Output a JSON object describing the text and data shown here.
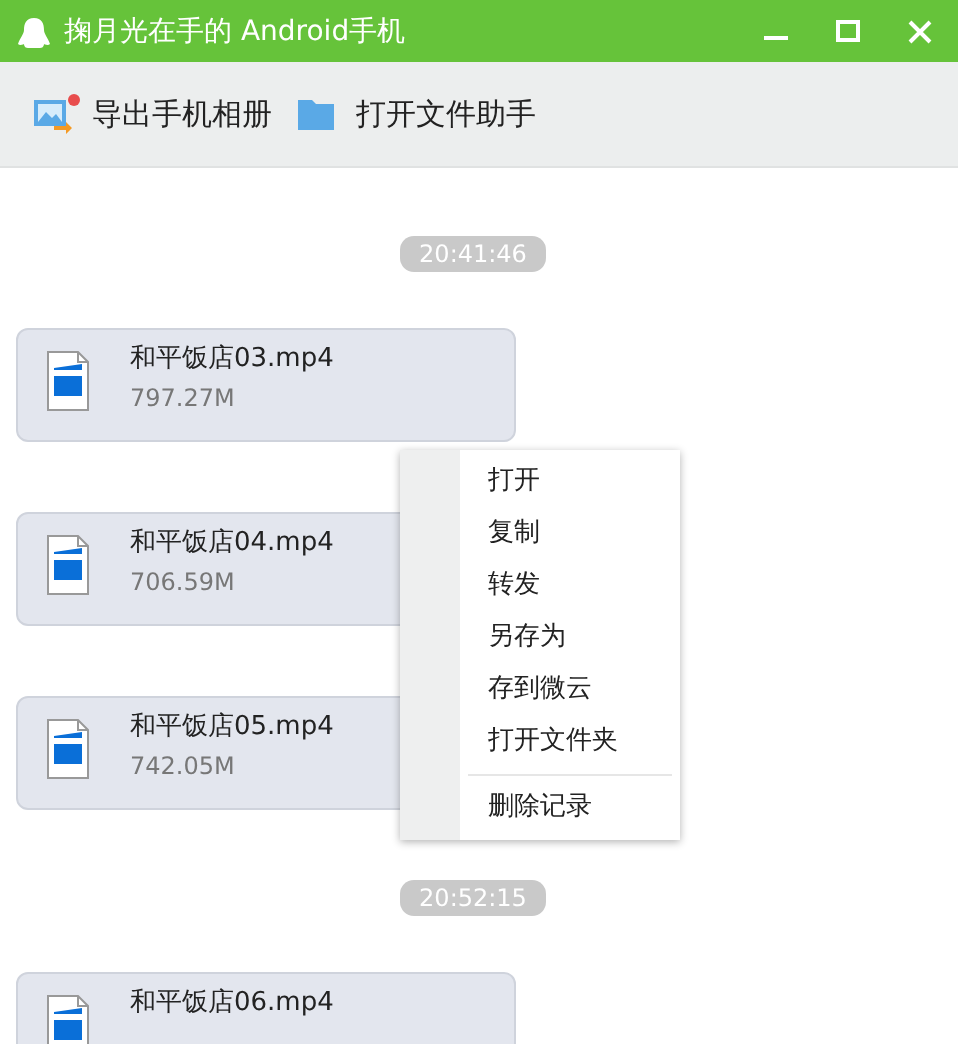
{
  "window": {
    "title": "掬月光在手的 Android手机"
  },
  "toolbar": [
    {
      "label": "导出手机相册",
      "kind": "album",
      "badge": true
    },
    {
      "label": "打开文件助手",
      "kind": "folder",
      "badge": false
    }
  ],
  "messages": [
    {
      "kind": "time",
      "text": "20:41:46"
    },
    {
      "kind": "file",
      "name": "和平饭店03.mp4",
      "size": "797.27M"
    },
    {
      "kind": "file",
      "name": "和平饭店04.mp4",
      "size": "706.59M"
    },
    {
      "kind": "file",
      "name": "和平饭店05.mp4",
      "size": "742.05M"
    },
    {
      "kind": "time",
      "text": "20:52:15"
    },
    {
      "kind": "file",
      "name": "和平饭店06.mp4"
    }
  ],
  "context_menu": {
    "groups": [
      [
        "打开",
        "复制",
        "转发",
        "另存为",
        "存到微云",
        "打开文件夹"
      ],
      [
        "删除记录"
      ]
    ]
  }
}
